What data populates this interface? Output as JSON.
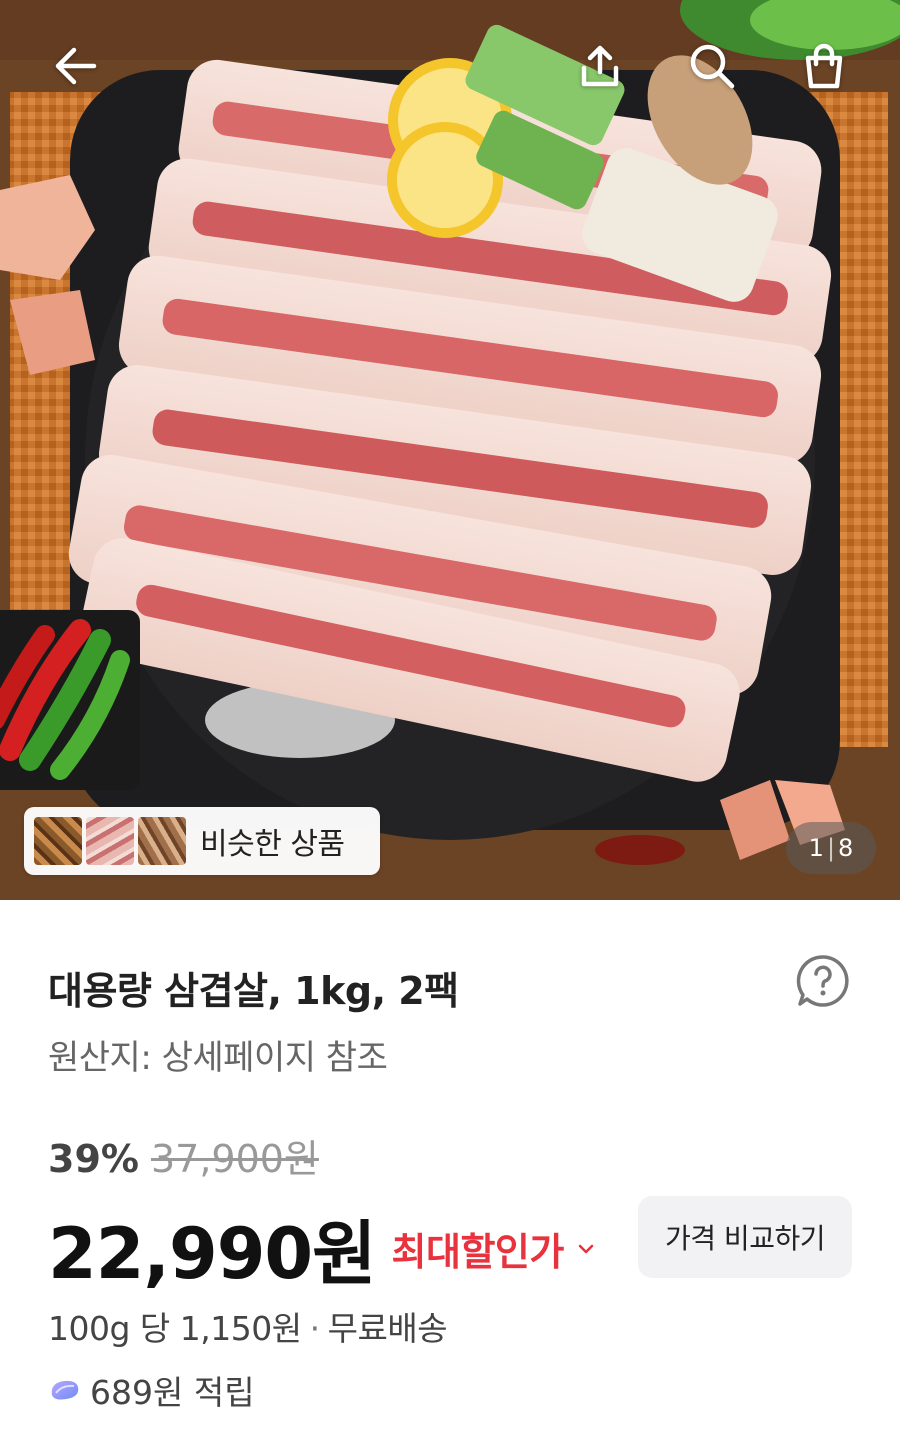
{
  "header": {
    "back_icon": "back-arrow-icon",
    "share_icon": "share-icon",
    "search_icon": "search-icon",
    "cart_icon": "shopping-bag-icon"
  },
  "gallery": {
    "similar_label": "비슷한 상품",
    "current_page": "1",
    "total_pages": "8"
  },
  "product": {
    "title": "대용량 삼겹살, 1kg, 2팩",
    "origin": "원산지: 상세페이지 참조",
    "discount_rate": "39%",
    "original_price": "37,900원",
    "price": "22,990원",
    "best_price_label": "최대할인가",
    "compare_button": "가격 비교하기",
    "unit_price": "100g 당 1,150원",
    "shipping": "무료배송",
    "reward": "689원 적립"
  },
  "colors": {
    "accent_red": "#e8323d",
    "reward_purple": "#8b7cf6"
  }
}
